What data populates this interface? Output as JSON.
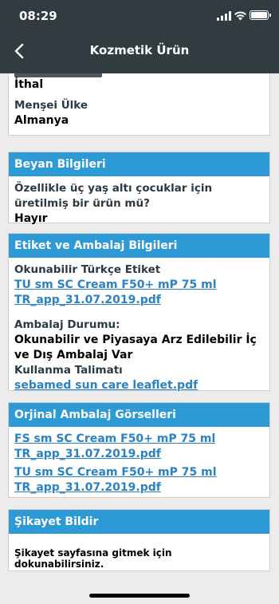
{
  "status_bar": {
    "time": "08:29"
  },
  "nav": {
    "title": "Kozmetik Ürün"
  },
  "card_origin": {
    "partial_value": "İthal",
    "country_label": "Menşei Ülke",
    "country_value": "Almanya"
  },
  "card_declaration": {
    "header": "Beyan Bilgileri",
    "question_line1": "Özellikle üç yaş altı çocuklar için",
    "question_line2": "üretilmiş bir ürün mü?",
    "answer": "Hayır"
  },
  "card_label": {
    "header": "Etiket ve Ambalaj Bilgileri",
    "turkish_label_title": "Okunabilir Türkçe Etiket",
    "turkish_label_link_line1": "TU sm SC Cream F50+ mP 75 ml",
    "turkish_label_link_line2": "TR_app_31.07.2019.pdf",
    "package_status_title": "Ambalaj Durumu:",
    "package_status_line1": "Okunabilir ve Piyasaya Arz Edilebilir İç",
    "package_status_line2": "ve Dış Ambalaj Var",
    "usage_title": "Kullanma Talimatı",
    "usage_link": "sebamed sun care leaflet.pdf"
  },
  "card_images": {
    "header": "Orjinal Ambalaj Görselleri",
    "link1_line1": "FS sm SC Cream F50+ mP 75 ml",
    "link1_line2": "TR_app_31.07.2019.pdf",
    "link2_line1": "TU sm SC Cream F50+ mP 75 ml",
    "link2_line2": "TR_app_31.07.2019.pdf"
  },
  "card_complaint": {
    "header": "Şikayet Bildir",
    "text": "Şikayet sayfasına gitmek için dokunabilirsiniz."
  },
  "colors": {
    "navbar": "#323b3f",
    "header_blue": "#2d9ad6",
    "link_blue": "#2b82c2",
    "background": "#ececec"
  },
  "icons": [
    "back-chevron-icon",
    "signal-icon",
    "wifi-icon",
    "battery-icon"
  ]
}
